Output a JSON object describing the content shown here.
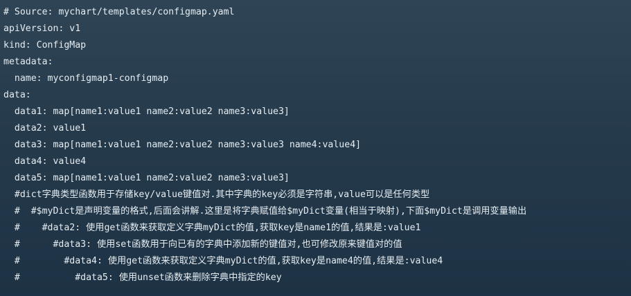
{
  "code": {
    "lines": [
      "# Source: mychart/templates/configmap.yaml",
      "apiVersion: v1",
      "kind: ConfigMap",
      "metadata:",
      "  name: myconfigmap1-configmap",
      "data:",
      "  data1: map[name1:value1 name2:value2 name3:value3]",
      "  data2: value1",
      "  data3: map[name1:value1 name2:value2 name3:value3 name4:value4]",
      "  data4: value4",
      "  data5: map[name1:value1 name2:value2 name3:value3]",
      "  #dict字典类型函数用于存储key/value键值对.其中字典的key必须是字符串,value可以是任何类型",
      "  #  #$myDict是声明变量的格式,后面会讲解.这里是将字典赋值给$myDict变量(相当于映射),下面$myDict是调用变量输出",
      "  #    #data2: 使用get函数来获取定义字典myDict的值,获取key是name1的值,结果是:value1",
      "  #      #data3: 使用set函数用于向已有的字典中添加新的键值对,也可修改原来键值对的值",
      "  #        #data4: 使用get函数来获取定义字典myDict的值,获取key是name4的值,结果是:value4",
      "  #          #data5: 使用unset函数来删除字典中指定的key"
    ]
  }
}
